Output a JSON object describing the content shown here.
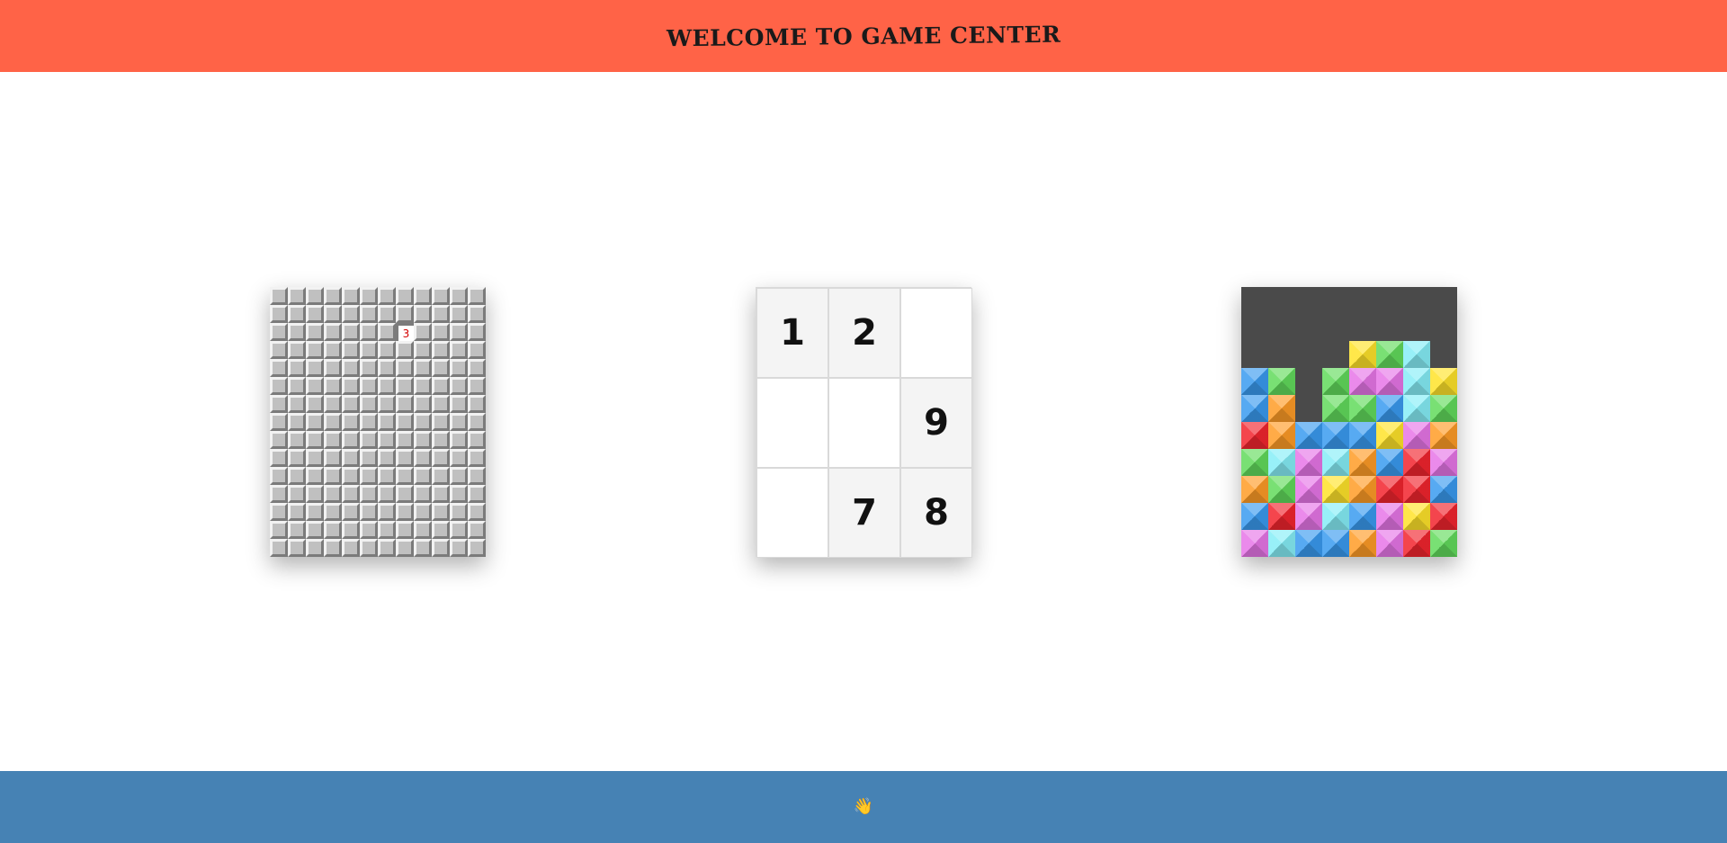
{
  "header": {
    "title": "WELCOME TO GAME CENTER"
  },
  "footer": {
    "icon": "waving-hand-icon",
    "emoji": "👋"
  },
  "games": {
    "minesweeper": {
      "name": "minesweeper-card",
      "revealed_number": "3",
      "revealed_row": 2,
      "revealed_col": 7
    },
    "sliding_puzzle": {
      "tiles": [
        "1",
        "2",
        "",
        "",
        "",
        "9",
        "",
        "7",
        "8"
      ]
    },
    "block_puzzle": {
      "rows": [
        "........",
        "........",
        "....YGC.",
        "BG.GPPCY",
        "BO.GGBCG",
        "ROBBBYPO",
        "GCPCOBRP",
        "OGPYORRB",
        "BRPCBPYR",
        "PCBBOPRG"
      ]
    }
  },
  "colors": {
    "header_bg": "#ff6347",
    "footer_bg": "#4682b4",
    "block_bg": "#4a4a4a",
    "B": "#3a9bf0",
    "G": "#62db5c",
    "Y": "#ffe32a",
    "C": "#86eef7",
    "P": "#e776e8",
    "R": "#f2252e",
    "O": "#ff9c27"
  }
}
